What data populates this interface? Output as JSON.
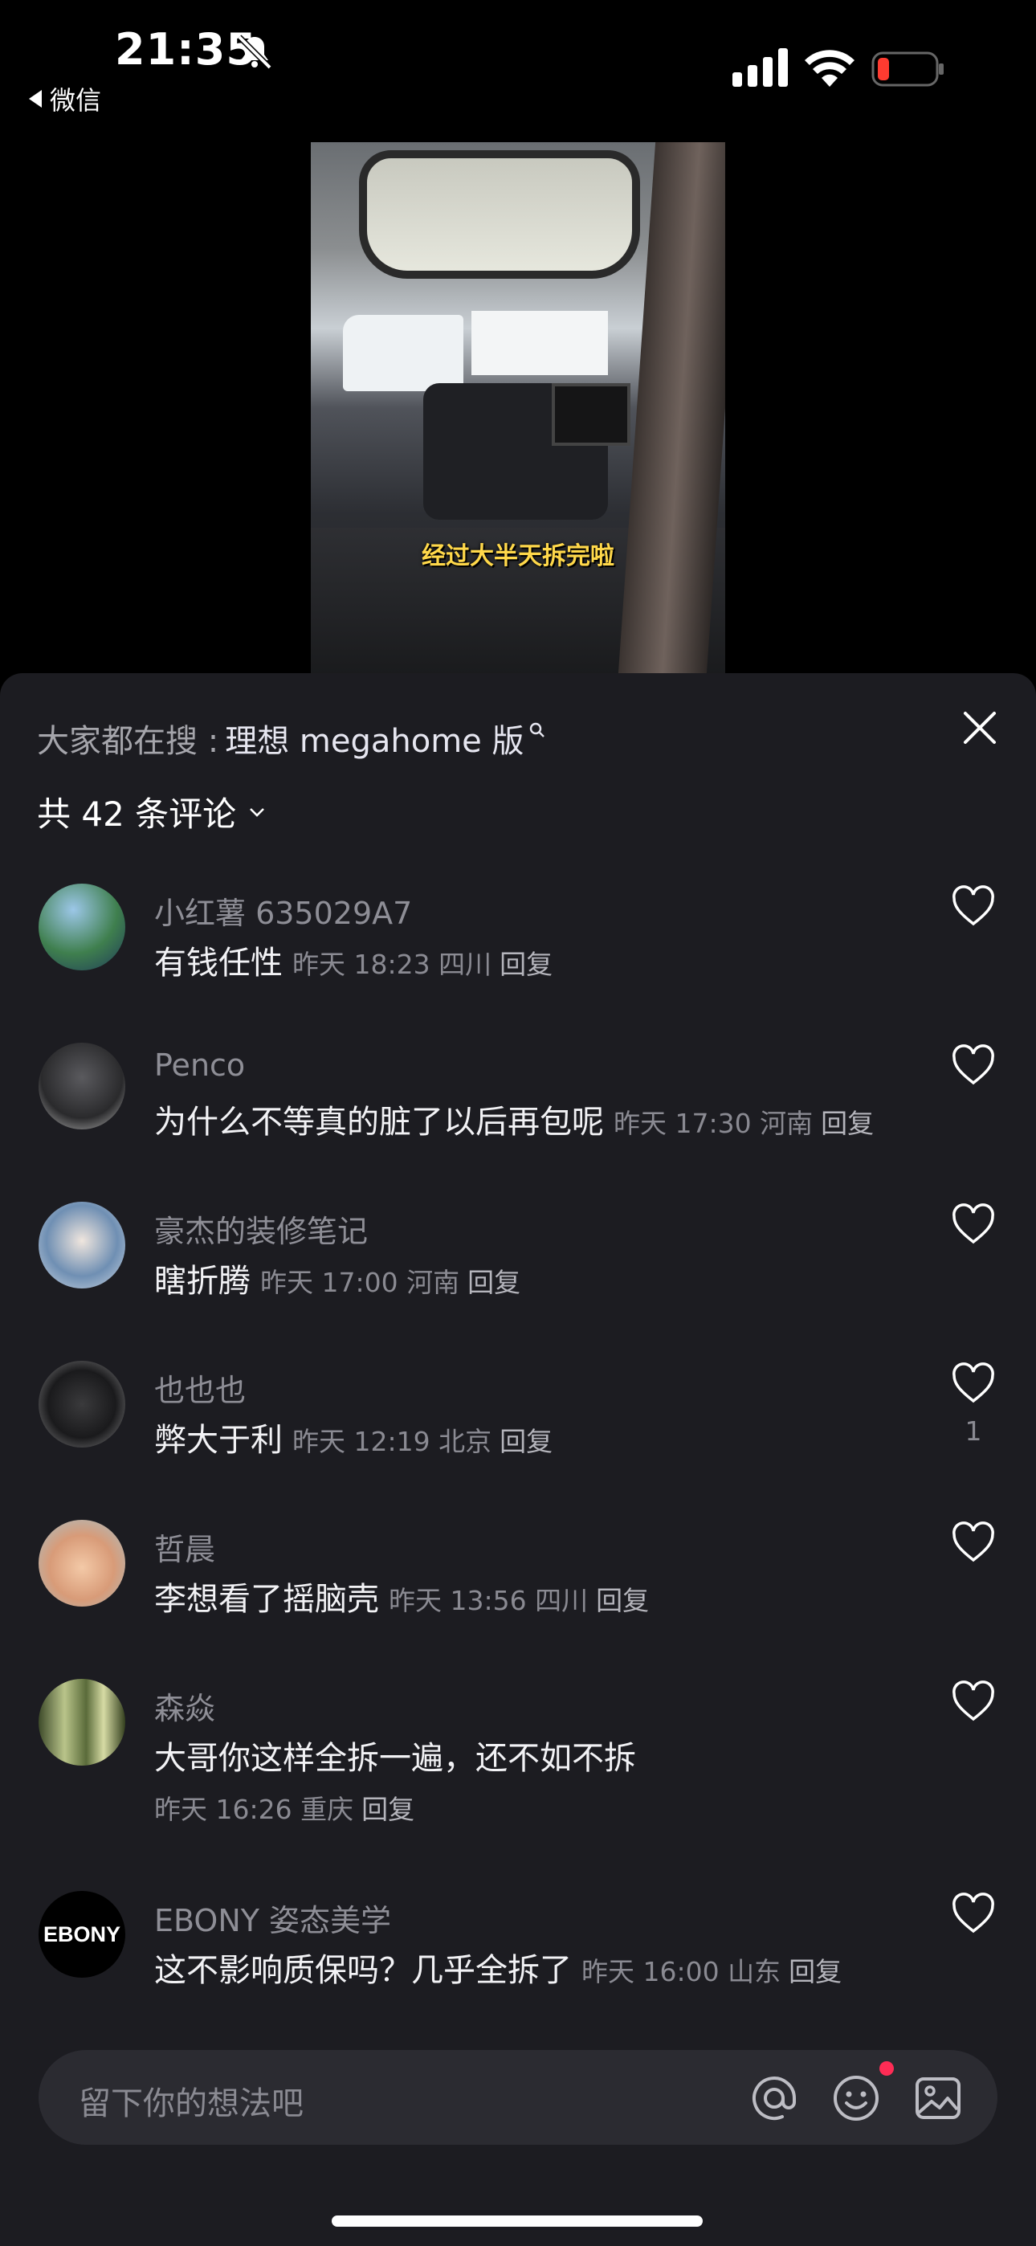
{
  "status_bar": {
    "time": "21:35",
    "back_app": "微信",
    "icons": [
      "bell-slash-icon",
      "signal-icon",
      "wifi-icon",
      "battery-low-icon"
    ],
    "battery_color": "#ff3b30"
  },
  "video": {
    "caption": "经过大半天拆完啦"
  },
  "sheet": {
    "search_prefix": "大家都在搜 :",
    "search_keyword": "理想 megahome 版",
    "comment_count": "共 42 条评论",
    "comments": [
      {
        "user": "小红薯 635029A7",
        "text": "有钱任性",
        "time": "昨天 18:23",
        "region": "四川",
        "reply": "回复",
        "likes": ""
      },
      {
        "user": "Penco",
        "text": "为什么不等真的脏了以后再包呢",
        "time": "昨天 17:30",
        "region": "河南",
        "reply": "回复",
        "likes": ""
      },
      {
        "user": "豪杰的装修笔记",
        "text": "瞎折腾",
        "time": "昨天 17:00",
        "region": "河南",
        "reply": "回复",
        "likes": ""
      },
      {
        "user": "也也也",
        "text": "弊大于利",
        "time": "昨天 12:19",
        "region": "北京",
        "reply": "回复",
        "likes": "1"
      },
      {
        "user": "哲晨",
        "text": "李想看了摇脑壳",
        "time": "昨天 13:56",
        "region": "四川",
        "reply": "回复",
        "likes": ""
      },
      {
        "user": "森焱",
        "text": "大哥你这样全拆一遍，还不如不拆",
        "time": "昨天 16:26",
        "region": "重庆",
        "reply": "回复",
        "likes": ""
      },
      {
        "user": "EBONY 姿态美学",
        "text": "这不影响质保吗？几乎全拆了",
        "time": "昨天 16:00",
        "region": "山东",
        "reply": "回复",
        "likes": "",
        "avatar_text": "EBONY"
      }
    ]
  },
  "input": {
    "placeholder": "留下你的想法吧",
    "icons": [
      "at-icon",
      "emoji-icon",
      "image-icon"
    ],
    "notification_color": "#fe2c55"
  }
}
